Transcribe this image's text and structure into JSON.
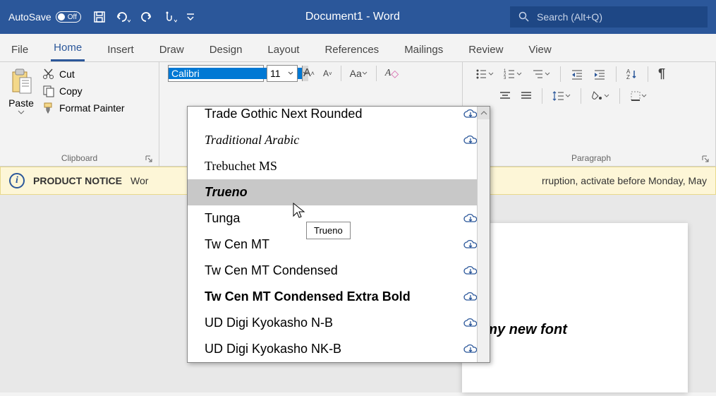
{
  "titlebar": {
    "autosave_label": "AutoSave",
    "autosave_state": "Off",
    "doc_title": "Document1 - Word",
    "search_placeholder": "Search (Alt+Q)"
  },
  "tabs": [
    "File",
    "Home",
    "Insert",
    "Draw",
    "Design",
    "Layout",
    "References",
    "Mailings",
    "Review",
    "View"
  ],
  "active_tab": "Home",
  "clipboard": {
    "paste": "Paste",
    "cut": "Cut",
    "copy": "Copy",
    "format_painter": "Format Painter",
    "group_label": "Clipboard"
  },
  "font": {
    "name": "Calibri",
    "size": "11"
  },
  "paragraph": {
    "group_label": "Paragraph"
  },
  "notice": {
    "label": "PRODUCT NOTICE",
    "text_left": "Wor",
    "text_right": "rruption, activate before Monday, May"
  },
  "font_dropdown": {
    "items": [
      {
        "name": "Trade Gothic Next Rounded",
        "cloud": true,
        "partial": true
      },
      {
        "name": "Traditional Arabic",
        "cloud": true,
        "style": "font-family: 'Times New Roman', serif; font-style: italic;"
      },
      {
        "name": "Trebuchet MS",
        "cloud": false,
        "style": "font-family: 'Trebuchet MS';"
      },
      {
        "name": "Trueno",
        "cloud": false,
        "hover": true,
        "style": "font-weight: 900; font-style: italic;"
      },
      {
        "name": "Tunga",
        "cloud": true
      },
      {
        "name": "Tw Cen MT",
        "cloud": true,
        "style": "font-family: 'Tw Cen MT', sans-serif;"
      },
      {
        "name": "Tw Cen MT Condensed",
        "cloud": true,
        "style": "font-family: 'Tw Cen MT Condensed', sans-serif; font-stretch: condensed;"
      },
      {
        "name": "Tw Cen MT Condensed Extra Bold",
        "cloud": true,
        "style": "font-weight: 900;"
      },
      {
        "name": "UD Digi Kyokasho N-B",
        "cloud": true
      },
      {
        "name": "UD Digi Kyokasho NK-B",
        "cloud": true
      }
    ],
    "tooltip": "Trueno"
  },
  "document": {
    "visible_text": "f my new font"
  }
}
